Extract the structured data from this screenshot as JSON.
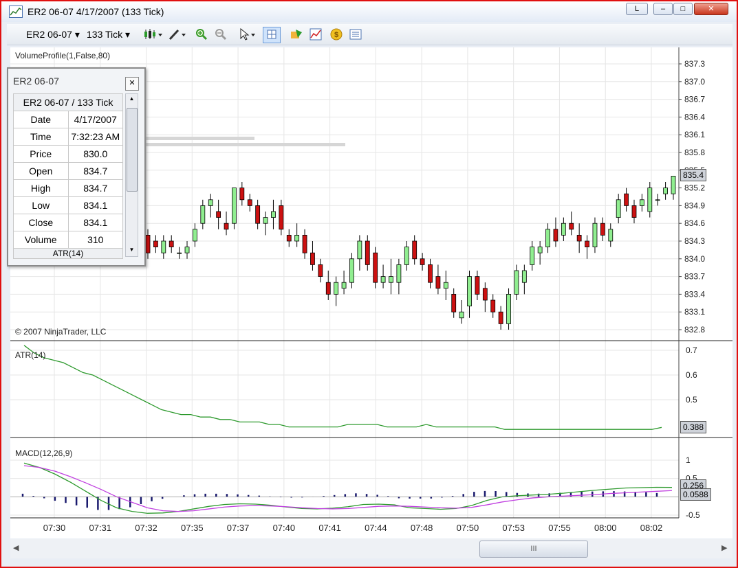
{
  "window": {
    "title": "ER2 06-07  4/17/2007  (133 Tick)",
    "link_button_label": "L",
    "minimize_glyph": "–",
    "maximize_glyph": "□",
    "close_glyph": "✕"
  },
  "toolbar": {
    "instrument": "ER2 06-07",
    "interval": "133 Tick",
    "icons": [
      "bar-type-icon",
      "drawing-tool-icon",
      "zoom-in-icon",
      "zoom-out-icon",
      "cursor-icon",
      "crosshair-icon",
      "strategies-icon",
      "indicators-icon",
      "money-icon",
      "properties-icon"
    ]
  },
  "chart": {
    "indicator_label": "VolumeProfile(1,False,80)",
    "copyright": "© 2007 NinjaTrader, LLC",
    "atr_label": "ATR(14)",
    "macd_label": "MACD(12,26,9)",
    "price_tag": "835.4",
    "atr_tag": "0.388",
    "macd_tag_1": "0.256",
    "macd_tag_2": "0.0588"
  },
  "databox": {
    "title": "ER2 06-07",
    "header": "ER2 06-07 / 133 Tick",
    "rows": [
      {
        "label": "Date",
        "value": "4/17/2007"
      },
      {
        "label": "Time",
        "value": "7:32:23 AM"
      },
      {
        "label": "Price",
        "value": "830.0"
      },
      {
        "label": "Open",
        "value": "834.7"
      },
      {
        "label": "High",
        "value": "834.7"
      },
      {
        "label": "Low",
        "value": "834.1"
      },
      {
        "label": "Close",
        "value": "834.1"
      },
      {
        "label": "Volume",
        "value": "310"
      }
    ],
    "footer_row": "ATR(14)"
  },
  "scrollbar": {
    "thumb_glyph": "III"
  },
  "chart_data": {
    "type": "candlestick",
    "colors": {
      "up": "#90ee90",
      "down": "#cc1111",
      "atr": "#2e9a2e",
      "macd": "#2e9a2e",
      "signal": "#c040e0",
      "hist": "#1a1a6e"
    },
    "price_axis": {
      "ticks": [
        "837.3",
        "837.0",
        "836.7",
        "836.4",
        "836.1",
        "835.8",
        "835.5",
        "835.2",
        "834.9",
        "834.6",
        "834.3",
        "834.0",
        "833.7",
        "833.4",
        "833.1",
        "832.8"
      ]
    },
    "atr_axis": {
      "ticks": [
        "0.7",
        "0.6",
        "0.5"
      ]
    },
    "macd_axis": {
      "ticks": [
        "1",
        "0.5",
        "0",
        "-0.5"
      ]
    },
    "time_axis": {
      "labels": [
        "07:30",
        "07:31",
        "07:32",
        "07:35",
        "07:37",
        "07:40",
        "07:41",
        "07:44",
        "07:48",
        "07:50",
        "07:53",
        "07:55",
        "08:00",
        "08:02"
      ]
    },
    "candles": [
      [
        834.4,
        834.5,
        834.0,
        834.1
      ],
      [
        834.3,
        834.4,
        834.1,
        834.2
      ],
      [
        834.1,
        834.4,
        834.0,
        834.3
      ],
      [
        834.3,
        834.4,
        834.1,
        834.2
      ],
      [
        834.1,
        834.2,
        834.0,
        834.1
      ],
      [
        834.1,
        834.3,
        834.0,
        834.2
      ],
      [
        834.3,
        834.6,
        834.2,
        834.5
      ],
      [
        834.6,
        835.0,
        834.5,
        834.9
      ],
      [
        834.9,
        835.1,
        834.7,
        835.0
      ],
      [
        834.8,
        835.0,
        834.5,
        834.7
      ],
      [
        834.6,
        834.8,
        834.4,
        834.5
      ],
      [
        834.6,
        835.2,
        834.5,
        835.2
      ],
      [
        835.2,
        835.3,
        834.9,
        835.0
      ],
      [
        835.0,
        835.1,
        834.8,
        834.9
      ],
      [
        834.9,
        835.0,
        834.5,
        834.6
      ],
      [
        834.6,
        834.8,
        834.4,
        834.7
      ],
      [
        834.7,
        835.0,
        834.5,
        834.8
      ],
      [
        834.9,
        835.0,
        834.4,
        834.5
      ],
      [
        834.4,
        834.5,
        834.2,
        834.3
      ],
      [
        834.3,
        834.6,
        834.2,
        834.4
      ],
      [
        834.4,
        834.5,
        834.0,
        834.1
      ],
      [
        834.1,
        834.3,
        833.8,
        833.9
      ],
      [
        833.9,
        834.0,
        833.6,
        833.7
      ],
      [
        833.6,
        833.8,
        833.3,
        833.4
      ],
      [
        833.4,
        833.7,
        833.2,
        833.6
      ],
      [
        833.5,
        833.8,
        833.4,
        833.6
      ],
      [
        833.6,
        834.1,
        833.5,
        834.0
      ],
      [
        834.0,
        834.4,
        833.8,
        834.3
      ],
      [
        834.3,
        834.4,
        833.8,
        833.9
      ],
      [
        834.1,
        834.2,
        833.5,
        833.6
      ],
      [
        833.6,
        833.9,
        833.5,
        833.7
      ],
      [
        833.6,
        834.0,
        833.4,
        833.7
      ],
      [
        833.6,
        834.0,
        833.4,
        833.9
      ],
      [
        833.9,
        834.3,
        833.8,
        834.2
      ],
      [
        834.3,
        834.4,
        833.9,
        834.0
      ],
      [
        834.0,
        834.1,
        833.8,
        833.9
      ],
      [
        833.9,
        834.0,
        833.5,
        833.6
      ],
      [
        833.7,
        833.9,
        833.4,
        833.5
      ],
      [
        833.5,
        833.8,
        833.3,
        833.6
      ],
      [
        833.4,
        833.5,
        833.0,
        833.1
      ],
      [
        833.0,
        833.3,
        832.9,
        833.1
      ],
      [
        833.2,
        833.8,
        833.0,
        833.7
      ],
      [
        833.7,
        833.8,
        833.3,
        833.4
      ],
      [
        833.5,
        833.6,
        833.1,
        833.3
      ],
      [
        833.3,
        833.4,
        833.0,
        833.1
      ],
      [
        833.1,
        833.2,
        832.8,
        832.9
      ],
      [
        832.9,
        833.5,
        832.8,
        833.4
      ],
      [
        833.4,
        833.9,
        833.3,
        833.8
      ],
      [
        833.6,
        833.9,
        833.4,
        833.8
      ],
      [
        833.9,
        834.3,
        833.8,
        834.2
      ],
      [
        834.1,
        834.3,
        833.9,
        834.2
      ],
      [
        834.2,
        834.6,
        834.1,
        834.5
      ],
      [
        834.5,
        834.7,
        834.2,
        834.3
      ],
      [
        834.4,
        834.7,
        834.3,
        834.6
      ],
      [
        834.6,
        834.8,
        834.4,
        834.5
      ],
      [
        834.4,
        834.6,
        834.1,
        834.3
      ],
      [
        834.3,
        834.4,
        834.0,
        834.2
      ],
      [
        834.2,
        834.7,
        834.1,
        834.6
      ],
      [
        834.6,
        834.7,
        834.3,
        834.4
      ],
      [
        834.3,
        834.6,
        834.2,
        834.5
      ],
      [
        834.7,
        835.1,
        834.6,
        835.0
      ],
      [
        835.1,
        835.2,
        834.8,
        834.9
      ],
      [
        834.9,
        835.0,
        834.6,
        834.7
      ],
      [
        834.9,
        835.1,
        834.8,
        835.0
      ],
      [
        834.8,
        835.3,
        834.7,
        835.2
      ],
      [
        835.0,
        835.1,
        834.9,
        835.0
      ],
      [
        835.1,
        835.3,
        835.0,
        835.2
      ],
      [
        835.1,
        835.4,
        835.0,
        835.4
      ]
    ],
    "atr": [
      0.72,
      0.69,
      0.67,
      0.66,
      0.65,
      0.63,
      0.61,
      0.6,
      0.58,
      0.56,
      0.54,
      0.52,
      0.5,
      0.48,
      0.46,
      0.45,
      0.44,
      0.44,
      0.43,
      0.43,
      0.42,
      0.42,
      0.41,
      0.41,
      0.41,
      0.4,
      0.4,
      0.39,
      0.39,
      0.39,
      0.39,
      0.39,
      0.39,
      0.4,
      0.4,
      0.4,
      0.4,
      0.39,
      0.39,
      0.39,
      0.39,
      0.4,
      0.39,
      0.39,
      0.39,
      0.39,
      0.39,
      0.39,
      0.39,
      0.38,
      0.38,
      0.38,
      0.38,
      0.38,
      0.38,
      0.38,
      0.38,
      0.38,
      0.38,
      0.38,
      0.38,
      0.38,
      0.38,
      0.38,
      0.38,
      0.388
    ],
    "macd": [
      0.92,
      0.8,
      0.62,
      0.4,
      0.15,
      -0.1,
      -0.3,
      -0.4,
      -0.45,
      -0.44,
      -0.4,
      -0.33,
      -0.26,
      -0.21,
      -0.19,
      -0.2,
      -0.23,
      -0.28,
      -0.32,
      -0.33,
      -0.31,
      -0.27,
      -0.21,
      -0.2,
      -0.22,
      -0.3,
      -0.32,
      -0.34,
      -0.32,
      -0.24,
      -0.1,
      0.0,
      0.03,
      0.05,
      0.07,
      0.1,
      0.14,
      0.18,
      0.21,
      0.24,
      0.25,
      0.26,
      0.256
    ],
    "signal": [
      0.85,
      0.8,
      0.7,
      0.55,
      0.38,
      0.2,
      0.0,
      -0.15,
      -0.3,
      -0.38,
      -0.4,
      -0.38,
      -0.33,
      -0.28,
      -0.25,
      -0.24,
      -0.25,
      -0.27,
      -0.3,
      -0.32,
      -0.33,
      -0.32,
      -0.29,
      -0.26,
      -0.25,
      -0.26,
      -0.28,
      -0.3,
      -0.31,
      -0.29,
      -0.22,
      -0.14,
      -0.08,
      -0.03,
      0.0,
      0.02,
      0.04,
      0.06,
      0.09,
      0.11,
      0.13,
      0.15,
      0.17
    ]
  }
}
